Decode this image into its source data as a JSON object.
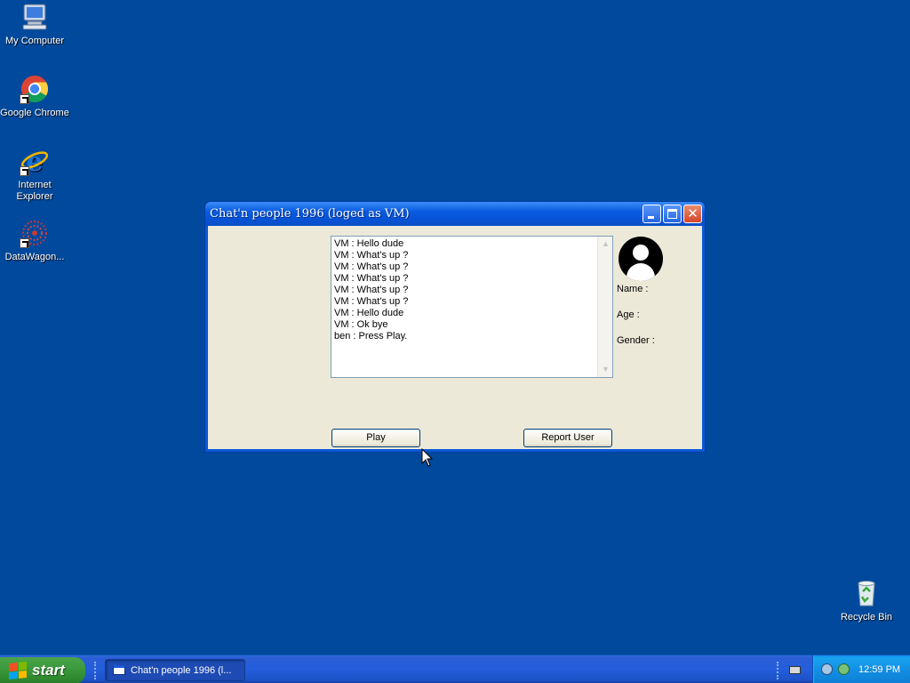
{
  "desktop": {
    "icons": [
      {
        "label": "My Computer"
      },
      {
        "label": "Google Chrome"
      },
      {
        "label": "Internet Explorer"
      },
      {
        "label": "DataWagon..."
      },
      {
        "label": "Recycle Bin"
      }
    ]
  },
  "window": {
    "title": "Chat'n people 1996 (loged as VM)",
    "chat_messages": [
      "VM : Hello dude",
      "VM : What's up ?",
      "VM : What's up ?",
      "VM : What's up ?",
      "VM : What's up ?",
      "VM : What's up ?",
      "VM : Hello dude",
      "VM : Ok bye",
      "ben : Press Play."
    ],
    "profile": {
      "name_label": "Name :",
      "age_label": "Age :",
      "gender_label": "Gender :"
    },
    "play_label": "Play",
    "report_label": "Report User"
  },
  "taskbar": {
    "start_label": "start",
    "task_label": "Chat'n people 1996 (l...",
    "clock": "12:59 PM"
  },
  "colors": {
    "desktop": "#00499c",
    "titlebar": "#0a5ce0",
    "start": "#3d9a3d",
    "tray": "#138fe3"
  }
}
